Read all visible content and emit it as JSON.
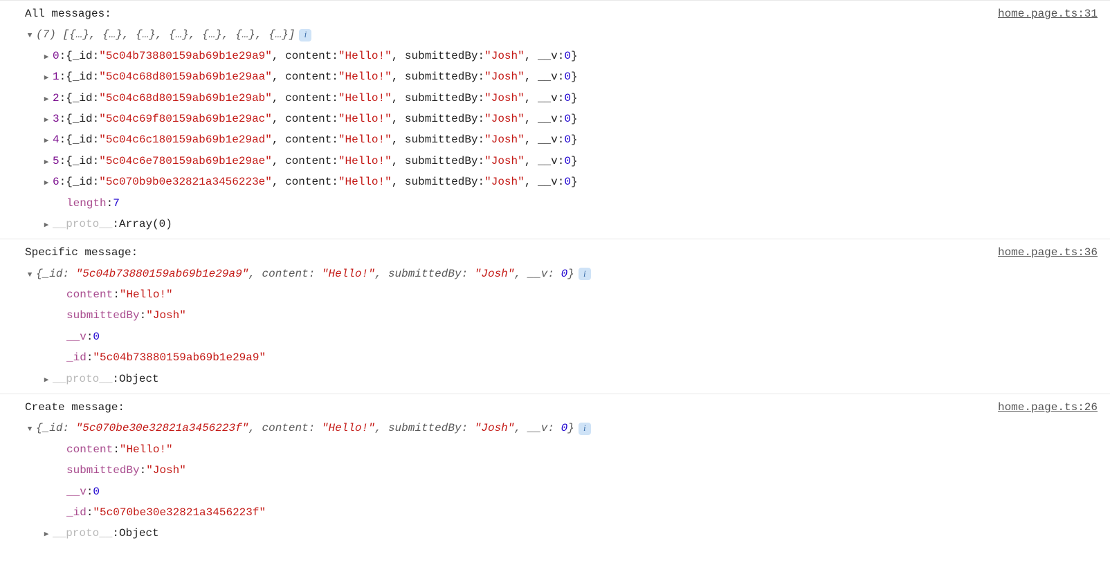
{
  "group1": {
    "label": "All messages:",
    "source": "home.page.ts:31",
    "summary_count": "(7)",
    "summary_body": "[{…}, {…}, {…}, {…}, {…}, {…}, {…}]",
    "items": [
      {
        "idx": "0",
        "id": "5c04b73880159ab69b1e29a9",
        "content": "Hello!",
        "submittedBy": "Josh",
        "v": "0"
      },
      {
        "idx": "1",
        "id": "5c04c68d80159ab69b1e29aa",
        "content": "Hello!",
        "submittedBy": "Josh",
        "v": "0"
      },
      {
        "idx": "2",
        "id": "5c04c68d80159ab69b1e29ab",
        "content": "Hello!",
        "submittedBy": "Josh",
        "v": "0"
      },
      {
        "idx": "3",
        "id": "5c04c69f80159ab69b1e29ac",
        "content": "Hello!",
        "submittedBy": "Josh",
        "v": "0"
      },
      {
        "idx": "4",
        "id": "5c04c6c180159ab69b1e29ad",
        "content": "Hello!",
        "submittedBy": "Josh",
        "v": "0"
      },
      {
        "idx": "5",
        "id": "5c04c6e780159ab69b1e29ae",
        "content": "Hello!",
        "submittedBy": "Josh",
        "v": "0"
      },
      {
        "idx": "6",
        "id": "5c070b9b0e32821a3456223e",
        "content": "Hello!",
        "submittedBy": "Josh",
        "v": "0"
      }
    ],
    "length_label": "length",
    "length_value": "7",
    "proto_label": "__proto__",
    "proto_value": "Array(0)"
  },
  "group2": {
    "label": "Specific message:",
    "source": "home.page.ts:36",
    "summary": {
      "id": "5c04b73880159ab69b1e29a9",
      "content": "Hello!",
      "submittedBy": "Josh",
      "v": "0"
    },
    "props": {
      "content_key": "content",
      "content_val": "Hello!",
      "submittedBy_key": "submittedBy",
      "submittedBy_val": "Josh",
      "v_key": "__v",
      "v_val": "0",
      "id_key": "_id",
      "id_val": "5c04b73880159ab69b1e29a9"
    },
    "proto_label": "__proto__",
    "proto_value": "Object"
  },
  "group3": {
    "label": "Create message:",
    "source": "home.page.ts:26",
    "summary": {
      "id": "5c070be30e32821a3456223f",
      "content": "Hello!",
      "submittedBy": "Josh",
      "v": "0"
    },
    "props": {
      "content_key": "content",
      "content_val": "Hello!",
      "submittedBy_key": "submittedBy",
      "submittedBy_val": "Josh",
      "v_key": "__v",
      "v_val": "0",
      "id_key": "_id",
      "id_val": "5c070be30e32821a3456223f"
    },
    "proto_label": "__proto__",
    "proto_value": "Object"
  },
  "keys": {
    "_id": "_id",
    "content": "content",
    "submittedBy": "submittedBy",
    "__v": "__v"
  }
}
